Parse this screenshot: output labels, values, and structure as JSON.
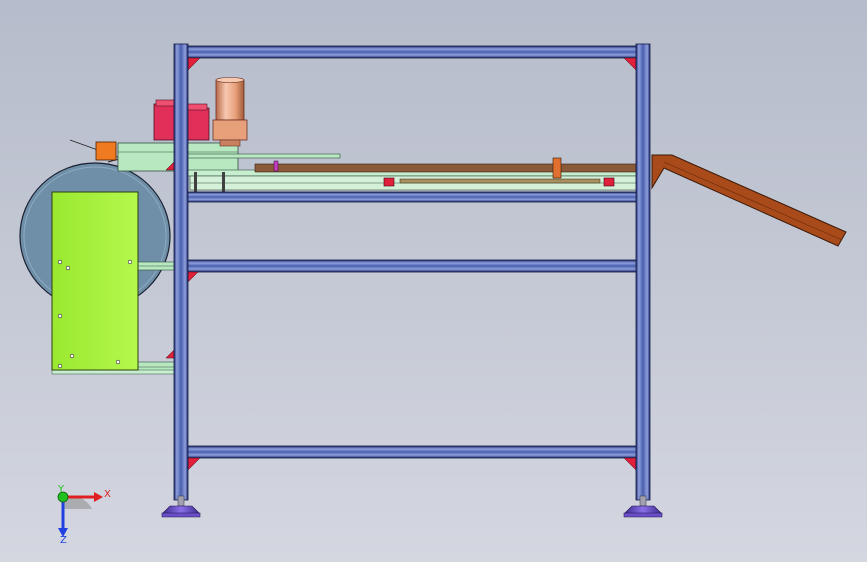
{
  "viewport": {
    "background_top": "#b6bccb",
    "background_bottom": "#d4d7e0"
  },
  "triad": {
    "x_label": "X",
    "y_label": "Y",
    "z_label": "Z",
    "x_color": "#e02020",
    "y_color": "#20c020",
    "z_color": "#2040e0"
  },
  "colors": {
    "frame_blue": "#4a5fae",
    "frame_dark": "#1e2a6e",
    "frame_light": "#8fa0dd",
    "gusset_red": "#e0203a",
    "roll_blue": "#6f8fa8",
    "panel_green": "#a4f03a",
    "motor_pink": "#e0305a",
    "cup_copper": "#e8a07a",
    "chute_brown": "#a84a1a",
    "orange_block": "#f07a20",
    "foot_purple": "#6a50c8",
    "rail_mint": "#b8e8c0"
  }
}
